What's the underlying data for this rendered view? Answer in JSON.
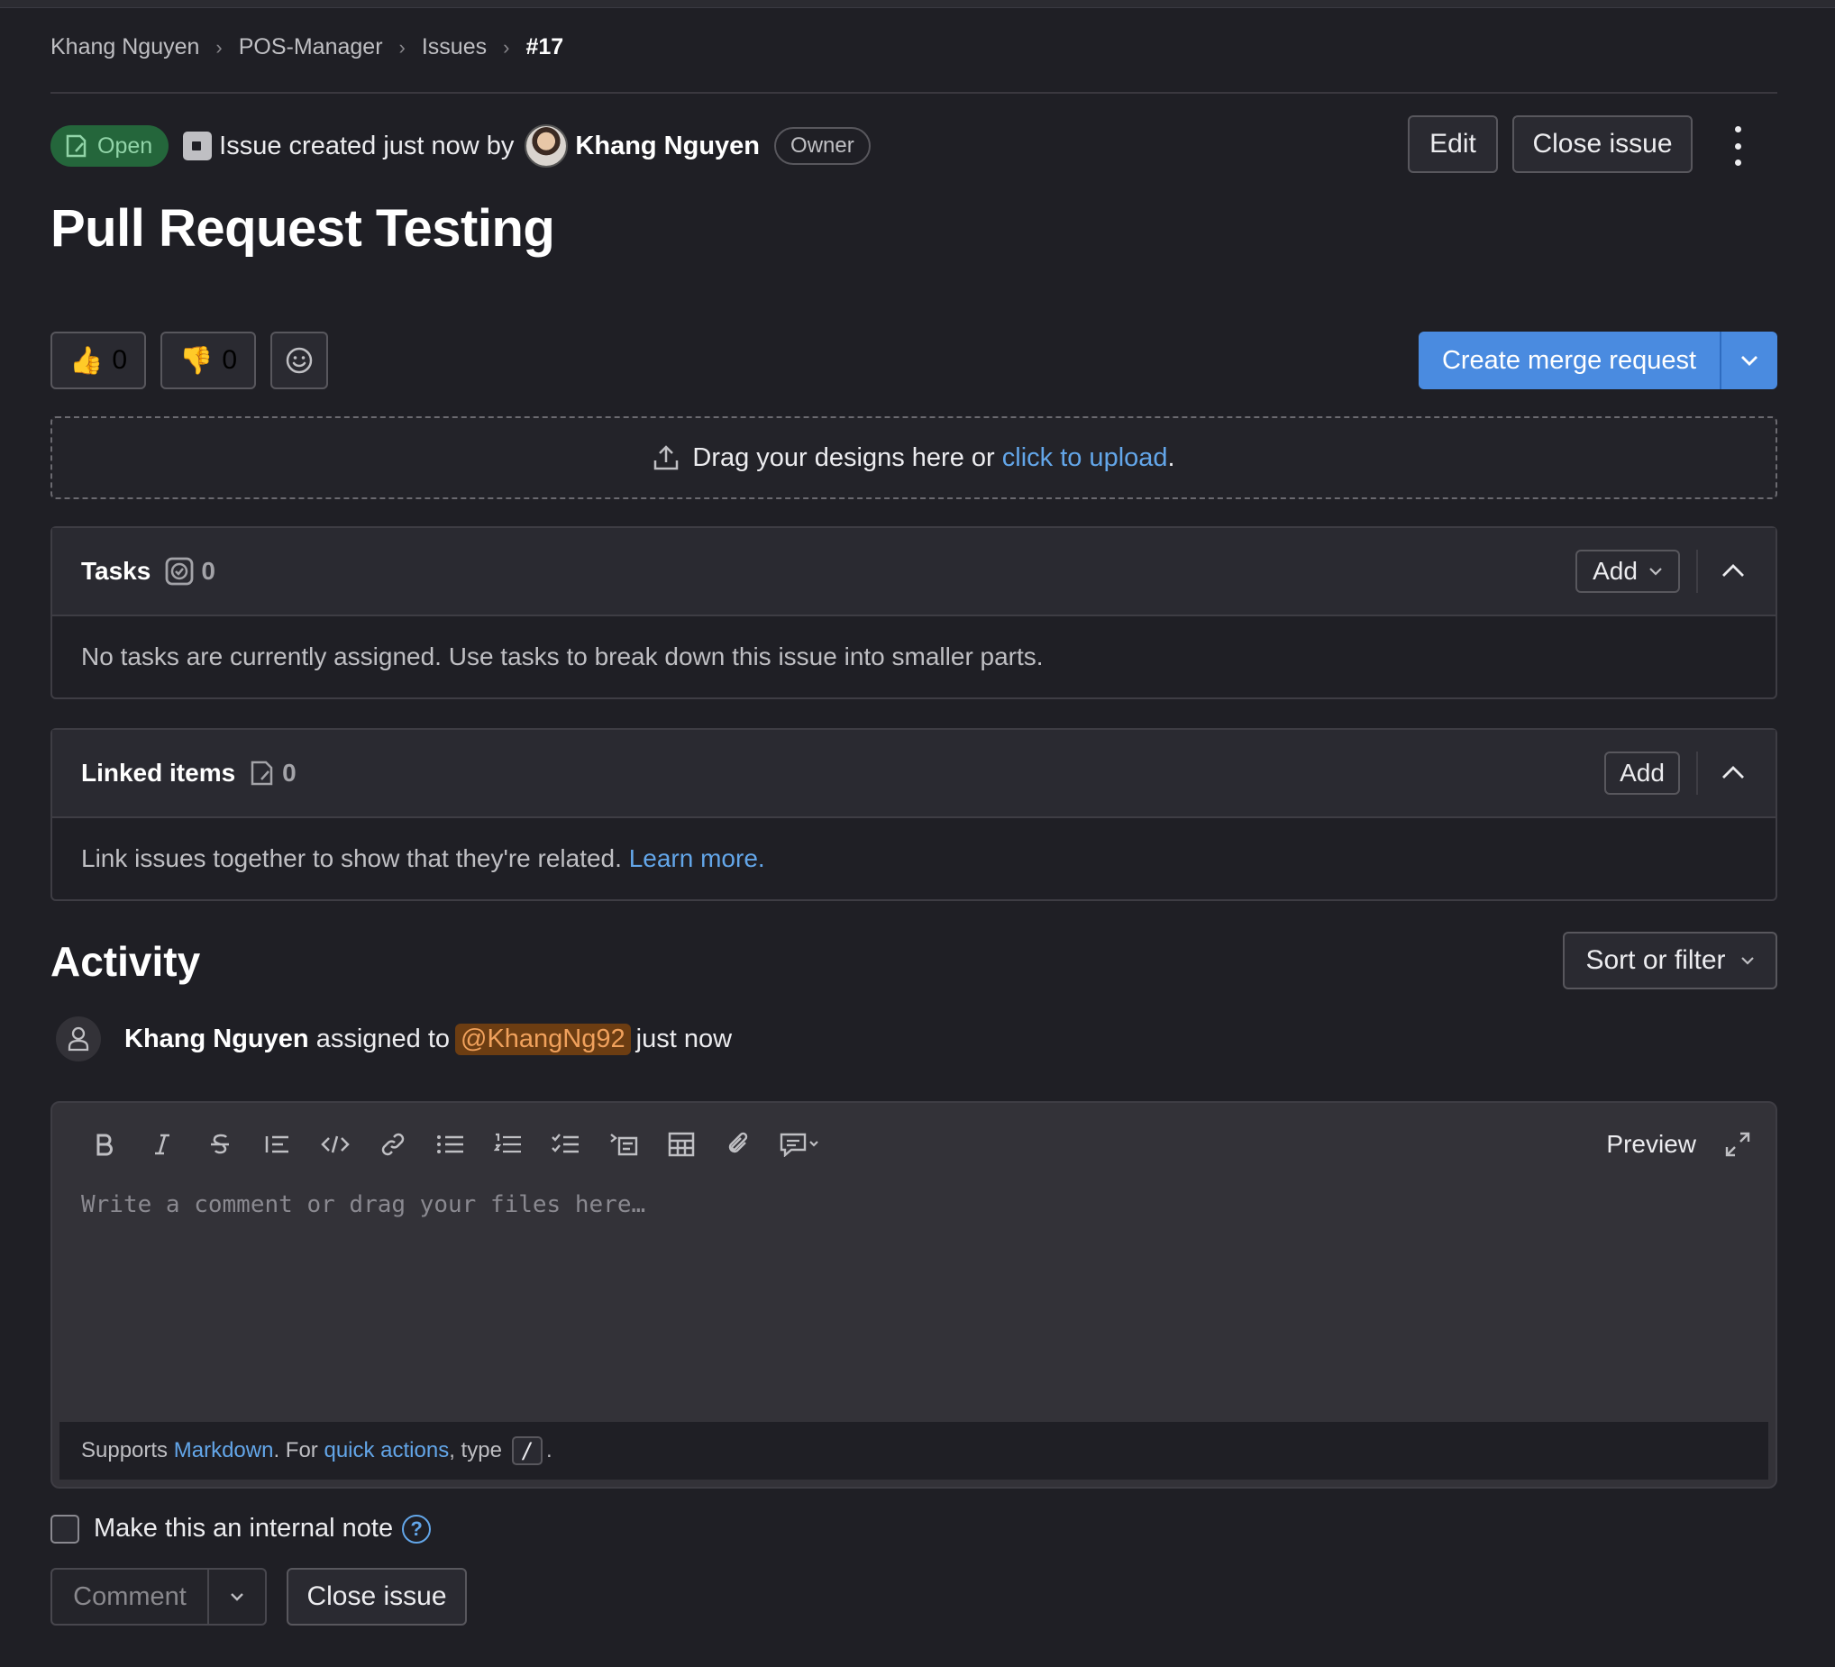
{
  "breadcrumb": {
    "items": [
      "Khang Nguyen",
      "POS-Manager",
      "Issues"
    ],
    "current": "#17"
  },
  "issue": {
    "status": "Open",
    "created_text": "Issue created just now by",
    "author": "Khang Nguyen",
    "author_role": "Owner",
    "title": "Pull Request Testing"
  },
  "actions": {
    "edit": "Edit",
    "close_issue": "Close issue"
  },
  "reactions": {
    "thumbs_up_emoji": "👍",
    "thumbs_up_count": "0",
    "thumbs_down_emoji": "👎",
    "thumbs_down_count": "0"
  },
  "merge": {
    "create_label": "Create merge request"
  },
  "designs": {
    "text_before": "Drag your designs here or",
    "link": "click to upload",
    "text_after": "."
  },
  "tasks": {
    "title": "Tasks",
    "count": "0",
    "add_label": "Add",
    "empty_text": "No tasks are currently assigned. Use tasks to break down this issue into smaller parts."
  },
  "linked_items": {
    "title": "Linked items",
    "count": "0",
    "add_label": "Add",
    "empty_text": "Link issues together to show that they're related.",
    "learn_more": "Learn more."
  },
  "activity": {
    "title": "Activity",
    "sort_label": "Sort or filter",
    "events": [
      {
        "actor": "Khang Nguyen",
        "action": "assigned to",
        "mention": "@KhangNg92",
        "time": "just now"
      }
    ]
  },
  "editor": {
    "preview_label": "Preview",
    "placeholder": "Write a comment or drag your files here…",
    "footer_supports": "Supports",
    "footer_markdown": "Markdown",
    "footer_for": ". For",
    "footer_quick_actions": "quick actions",
    "footer_type": ", type",
    "footer_key": "/",
    "footer_end": "."
  },
  "internal_note": {
    "label": "Make this an internal note",
    "help": "?"
  },
  "comment": {
    "label": "Comment",
    "close_issue": "Close issue"
  },
  "colors": {
    "background": "#1f1f25",
    "primary": "#4a8be0",
    "open_badge_bg": "#24663b",
    "open_badge_fg": "#91d4a8",
    "link": "#63a6e9",
    "mention_bg": "#6c3d12"
  }
}
